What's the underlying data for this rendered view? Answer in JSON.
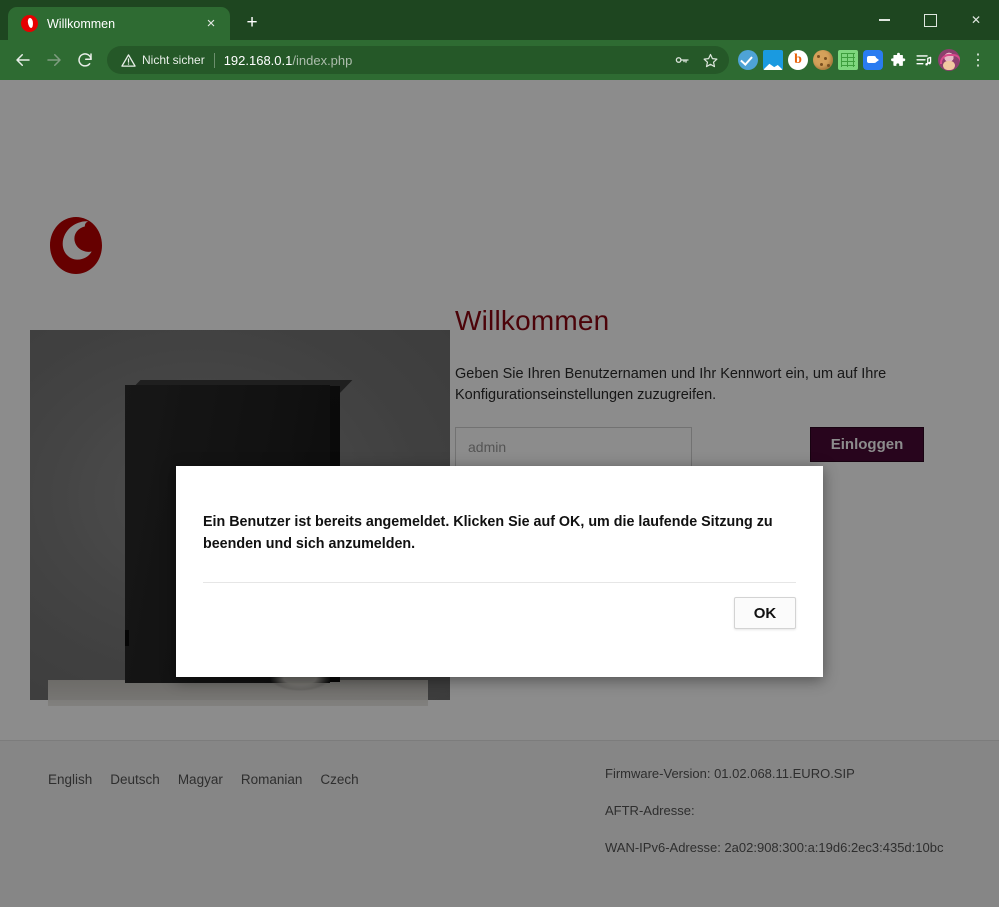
{
  "browser": {
    "tab": {
      "title": "Willkommen",
      "favicon": "vodafone-favicon",
      "close_label": "×"
    },
    "new_tab_label": "+",
    "window": {
      "minimize": "–",
      "maximize": "□",
      "close": "✕"
    },
    "nav": {
      "back": "back-arrow",
      "forward": "forward-arrow",
      "reload": "reload-arrow"
    },
    "omnibox": {
      "security_label": "Nicht sicher",
      "url_host": "192.168.0.1",
      "url_path": "/index.php",
      "full_url": "192.168.0.1/index.php"
    },
    "toolbar_icons": [
      "password-key-icon",
      "bookmark-star-icon",
      "checkmark-extension-icon",
      "image-extension-icon",
      "bitwarden-extension-icon",
      "cookie-extension-icon",
      "sheet-extension-icon",
      "video-camera-extension-icon",
      "puzzle-extensions-icon",
      "reading-list-icon",
      "profile-avatar",
      "chrome-menu-icon"
    ],
    "bitwarden_glyph": "b",
    "menu_glyph": "⋮",
    "puzzle_glyph": "🧩",
    "readinglist_glyph": "☰"
  },
  "page": {
    "brand": "Vodafone",
    "heading": "Willkommen",
    "description": "Geben Sie Ihren Benutzernamen und Ihr Kennwort ein, um auf Ihre Konfigurationseinstellungen zuzugreifen.",
    "username_placeholder": "admin",
    "username_value": "",
    "password_placeholder": "",
    "password_value": "",
    "login_button": "Einloggen",
    "languages": [
      "English",
      "Deutsch",
      "Magyar",
      "Romanian",
      "Czech"
    ],
    "firmware": {
      "version_line": "Firmware-Version: 01.02.068.11.EURO.SIP",
      "aftr_line": "AFTR-Adresse:",
      "wan_ipv6_line": "WAN-IPv6-Adresse: 2a02:908:300:a:19d6:2ec3:435d:10bc"
    }
  },
  "dialog": {
    "message": "Ein Benutzer ist bereits angemeldet. Klicken Sie auf OK, um die laufende Sitzung zu beenden und sich anzumelden.",
    "ok_label": "OK"
  },
  "colors": {
    "chrome_frame": "#1e4620",
    "chrome_toolbar": "#2e6b32",
    "vodafone_red": "#e60000",
    "heading_red": "#8a0712",
    "login_button": "#4a0a36",
    "scrim": "rgba(0,0,0,0.45)"
  }
}
